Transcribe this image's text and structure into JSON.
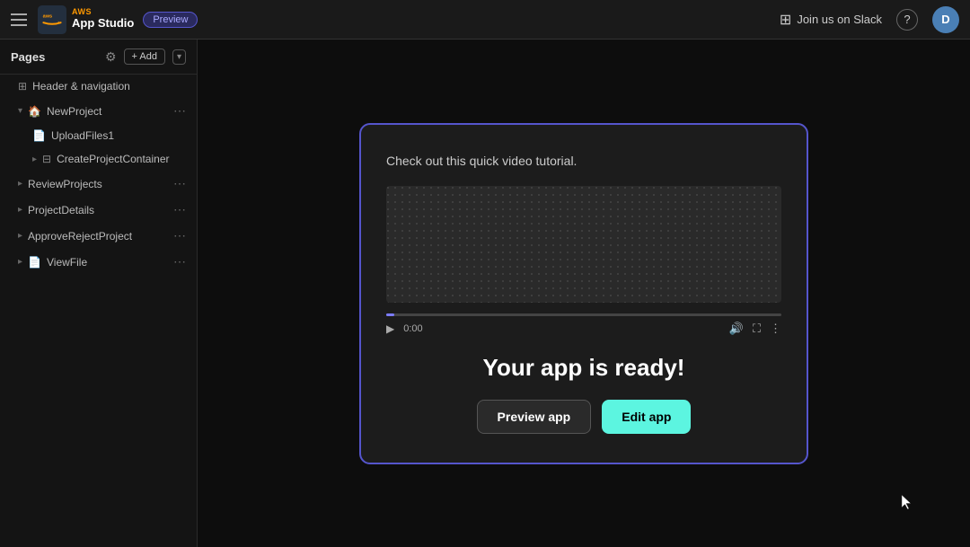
{
  "topnav": {
    "brand_aws": "AWS",
    "brand_studio": "App Studio",
    "preview_badge": "Preview",
    "slack_label": "Join us on Slack",
    "help_label": "?",
    "avatar_label": "D"
  },
  "sidebar": {
    "title": "Pages",
    "add_label": "+ Add",
    "header_navigation_label": "Header & navigation",
    "items": [
      {
        "label": "NewProject",
        "icon": "🏠",
        "indent": 1,
        "expandable": true,
        "has_more": true
      },
      {
        "label": "UploadFiles1",
        "icon": "📄",
        "indent": 2,
        "expandable": false,
        "has_more": false
      },
      {
        "label": "CreateProjectContainer",
        "icon": "⊞",
        "indent": 2,
        "expandable": true,
        "has_more": false
      },
      {
        "label": "ReviewProjects",
        "icon": "",
        "indent": 1,
        "expandable": true,
        "has_more": true
      },
      {
        "label": "ProjectDetails",
        "icon": "",
        "indent": 1,
        "expandable": true,
        "has_more": true
      },
      {
        "label": "ApproveRejectProject",
        "icon": "",
        "indent": 1,
        "expandable": true,
        "has_more": true
      },
      {
        "label": "ViewFile",
        "icon": "",
        "indent": 1,
        "expandable": true,
        "has_more": true
      }
    ]
  },
  "modal": {
    "subtitle": "Check out this quick video tutorial.",
    "ready_title": "Your app is ready!",
    "preview_btn": "Preview app",
    "edit_btn": "Edit app",
    "video_time": "0:00",
    "progress_pct": 2
  }
}
